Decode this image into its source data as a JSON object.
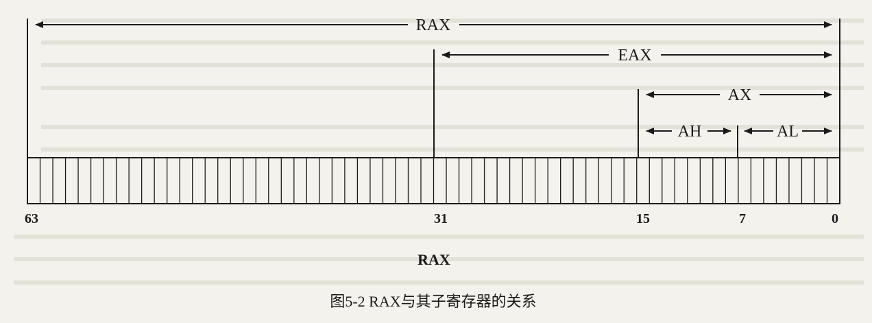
{
  "diagram": {
    "registers": [
      {
        "name": "RAX",
        "from_bit": 63,
        "to_bit": 0
      },
      {
        "name": "EAX",
        "from_bit": 31,
        "to_bit": 0
      },
      {
        "name": "AX",
        "from_bit": 15,
        "to_bit": 0
      },
      {
        "name": "AH",
        "from_bit": 15,
        "to_bit": 7
      },
      {
        "name": "AL",
        "from_bit": 7,
        "to_bit": 0
      }
    ],
    "bit_labels": [
      "63",
      "31",
      "15",
      "7",
      "0"
    ],
    "register_title": "RAX",
    "caption": "图5-2  RAX与其子寄存器的关系"
  }
}
